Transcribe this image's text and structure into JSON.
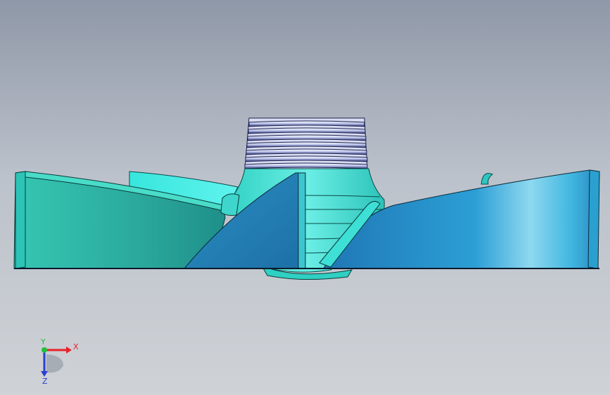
{
  "viewport": {
    "colors": {
      "background_top": "#8f98a8",
      "background_bottom": "#cfd2d6",
      "teal": "#2fb3a6",
      "cyan": "#3fe0d8",
      "blue": "#1f78b8",
      "highlight": "#bff6f7"
    }
  },
  "triad": {
    "x_label": "X",
    "y_label": "Y",
    "z_label": "Z",
    "x_color": "#e8222a",
    "y_color": "#22c03a",
    "z_color": "#2a3fd0"
  }
}
